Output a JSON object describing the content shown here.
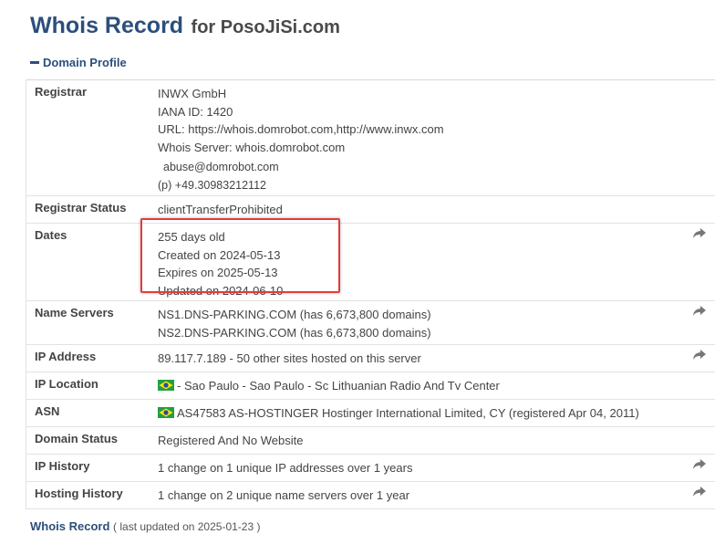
{
  "header": {
    "title": "Whois Record",
    "subtitle": "for PosoJiSi.com"
  },
  "section": {
    "label": "Domain Profile"
  },
  "registrar": {
    "label": "Registrar",
    "name": "INWX GmbH",
    "iana": "IANA ID: 1420",
    "url": "URL: https://whois.domrobot.com,http://www.inwx.com",
    "whois_server": "Whois Server: whois.domrobot.com",
    "email": "abuse@domrobot.com",
    "phone_prefix": "(p)",
    "phone": "+49.30983212112"
  },
  "registrar_status": {
    "label": "Registrar Status",
    "value": "clientTransferProhibited"
  },
  "dates": {
    "label": "Dates",
    "age": "255 days old",
    "created": "Created on 2024-05-13",
    "expires": "Expires on 2025-05-13",
    "updated": "Updated on 2024-06-10"
  },
  "name_servers": {
    "label": "Name Servers",
    "ns1": "NS1.DNS-PARKING.COM (has 6,673,800 domains)",
    "ns2": "NS2.DNS-PARKING.COM (has 6,673,800 domains)"
  },
  "ip_address": {
    "label": "IP Address",
    "value": "89.117.7.189 - 50 other sites hosted on this server"
  },
  "ip_location": {
    "label": "IP Location",
    "value": "- Sao Paulo - Sao Paulo - Sc Lithuanian Radio And Tv Center"
  },
  "asn": {
    "label": "ASN",
    "value": "AS47583 AS-HOSTINGER Hostinger International Limited, CY (registered Apr 04, 2011)"
  },
  "domain_status": {
    "label": "Domain Status",
    "value": "Registered And No Website"
  },
  "ip_history": {
    "label": "IP History",
    "value": "1 change on 1 unique IP addresses over 1 years"
  },
  "hosting_history": {
    "label": "Hosting History",
    "value": "1 change on 2 unique name servers over 1 year"
  },
  "footer": {
    "link": "Whois Record",
    "note": "( last updated on 2025-01-23 )"
  },
  "colors": {
    "title": "#2c4f7c",
    "highlight": "#e53b3b",
    "arrow": "#777777"
  },
  "icons": {
    "arrow": "share-arrow-icon",
    "flag": "brazil-flag-icon"
  }
}
